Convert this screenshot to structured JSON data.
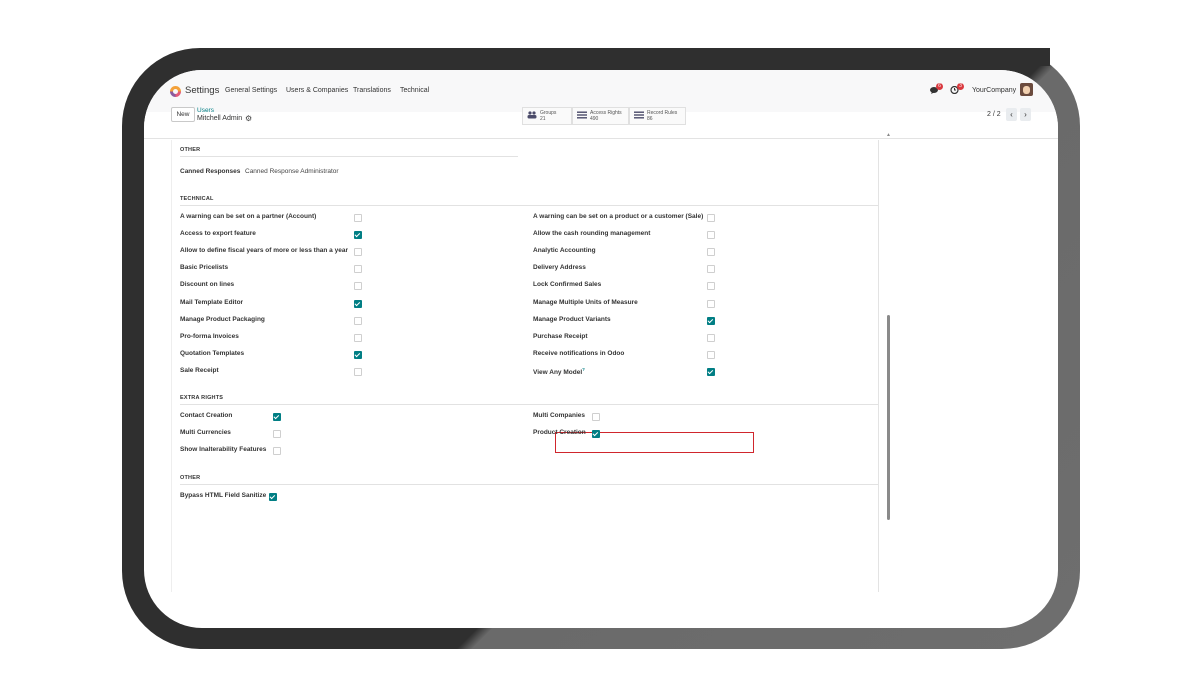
{
  "topbar": {
    "app_name": "Settings",
    "menus": [
      "General Settings",
      "Users & Companies",
      "Translations",
      "Technical"
    ],
    "messages_badge": "6",
    "activities_badge": "3",
    "company": "YourCompany"
  },
  "controlbar": {
    "new_label": "New",
    "breadcrumb_parent": "Users",
    "breadcrumb_current": "Mitchell Admin",
    "smart_buttons": [
      {
        "label": "Groups",
        "count": "21",
        "icon": "groups-icon"
      },
      {
        "label": "Access Rights",
        "count": "490",
        "icon": "list-icon"
      },
      {
        "label": "Record Rules",
        "count": "86",
        "icon": "list-icon"
      }
    ],
    "pager": "2 / 2"
  },
  "sections": {
    "other_top": {
      "title": "OTHER",
      "field_label": "Canned Responses",
      "field_value": "Canned Response Administrator"
    },
    "technical": {
      "title": "TECHNICAL",
      "left": [
        {
          "label": "A warning can be set on a partner (Account)",
          "checked": false
        },
        {
          "label": "Access to export feature",
          "checked": true
        },
        {
          "label": "Allow to define fiscal years of more or less than a year",
          "checked": false
        },
        {
          "label": "Basic Pricelists",
          "checked": false
        },
        {
          "label": "Discount on lines",
          "checked": false
        },
        {
          "label": "Mail Template Editor",
          "checked": true
        },
        {
          "label": "Manage Product Packaging",
          "checked": false
        },
        {
          "label": "Pro-forma Invoices",
          "checked": false
        },
        {
          "label": "Quotation Templates",
          "checked": true
        },
        {
          "label": "Sale Receipt",
          "checked": false
        }
      ],
      "right": [
        {
          "label": "A warning can be set on a product or a customer (Sale)",
          "checked": false
        },
        {
          "label": "Allow the cash rounding management",
          "checked": false
        },
        {
          "label": "Analytic Accounting",
          "checked": false
        },
        {
          "label": "Delivery Address",
          "checked": false
        },
        {
          "label": "Lock Confirmed Sales",
          "checked": false
        },
        {
          "label": "Manage Multiple Units of Measure",
          "checked": false
        },
        {
          "label": "Manage Product Variants",
          "checked": true
        },
        {
          "label": "Purchase Receipt",
          "checked": false
        },
        {
          "label": "Receive notifications in Odoo",
          "checked": false
        },
        {
          "label": "View Any Model",
          "sup": "?",
          "checked": true
        }
      ]
    },
    "extra_rights": {
      "title": "EXTRA RIGHTS",
      "left": [
        {
          "label": "Contact Creation",
          "checked": true
        },
        {
          "label": "Multi Currencies",
          "checked": false
        },
        {
          "label": "Show Inalterability Features",
          "checked": false
        }
      ],
      "right": [
        {
          "label": "Multi Companies",
          "checked": false
        },
        {
          "label": "Product Creation",
          "checked": true
        }
      ]
    },
    "other_bottom": {
      "title": "OTHER",
      "left": [
        {
          "label": "Bypass HTML Field Sanitize",
          "checked": true
        }
      ]
    }
  }
}
